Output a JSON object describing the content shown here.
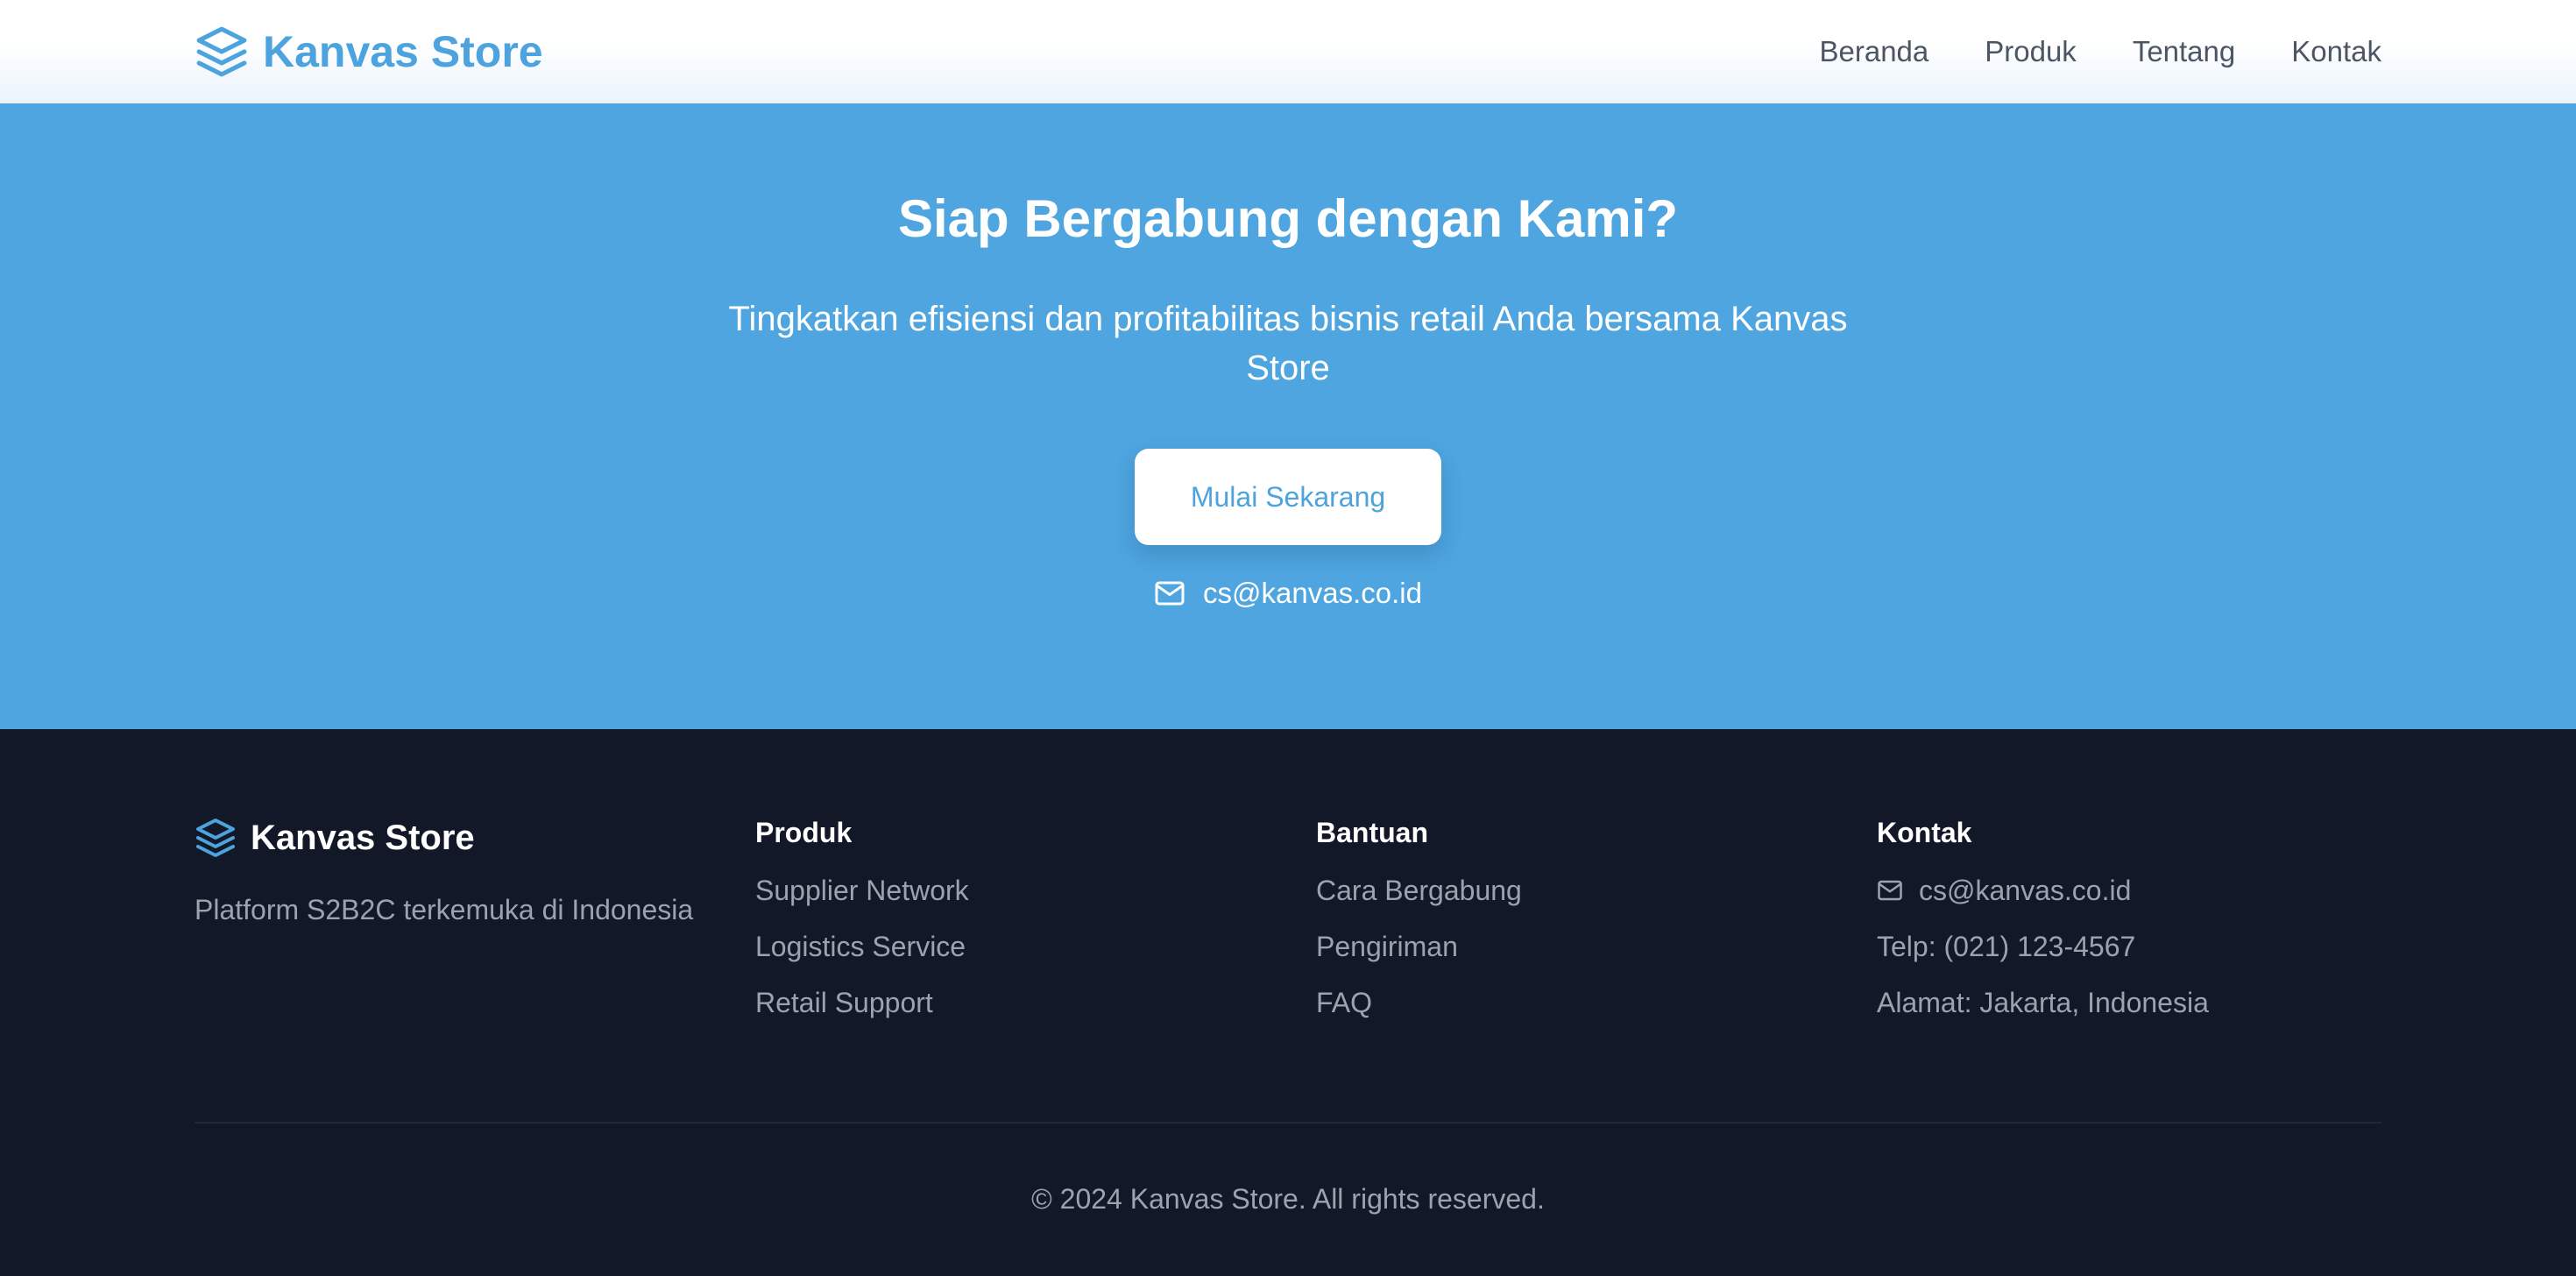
{
  "header": {
    "brand": "Kanvas Store",
    "logo_icon": "layers-icon",
    "nav": [
      "Beranda",
      "Produk",
      "Tentang",
      "Kontak"
    ]
  },
  "hero": {
    "title": "Siap Bergabung dengan Kami?",
    "subtitle": "Tingkatkan efisiensi dan profitabilitas bisnis retail Anda bersama Kanvas Store",
    "cta_label": "Mulai Sekarang",
    "email": "cs@kanvas.co.id",
    "email_icon": "mail-icon"
  },
  "footer": {
    "brand": "Kanvas Store",
    "tagline": "Platform S2B2C terkemuka di Indonesia",
    "columns": [
      {
        "title": "Produk",
        "items": [
          "Supplier Network",
          "Logistics Service",
          "Retail Support"
        ]
      },
      {
        "title": "Bantuan",
        "items": [
          "Cara Bergabung",
          "Pengiriman",
          "FAQ"
        ]
      },
      {
        "title": "Kontak",
        "items": [
          "cs@kanvas.co.id",
          "Telp: (021) 123-4567",
          "Alamat: Jakarta, Indonesia"
        ]
      }
    ],
    "copyright": "© 2024 Kanvas Store. All rights reserved."
  },
  "colors": {
    "brand_blue": "#4ca3dd",
    "hero_bg": "#4ea5df",
    "footer_bg": "#121827",
    "footer_text": "#9ca3af"
  }
}
